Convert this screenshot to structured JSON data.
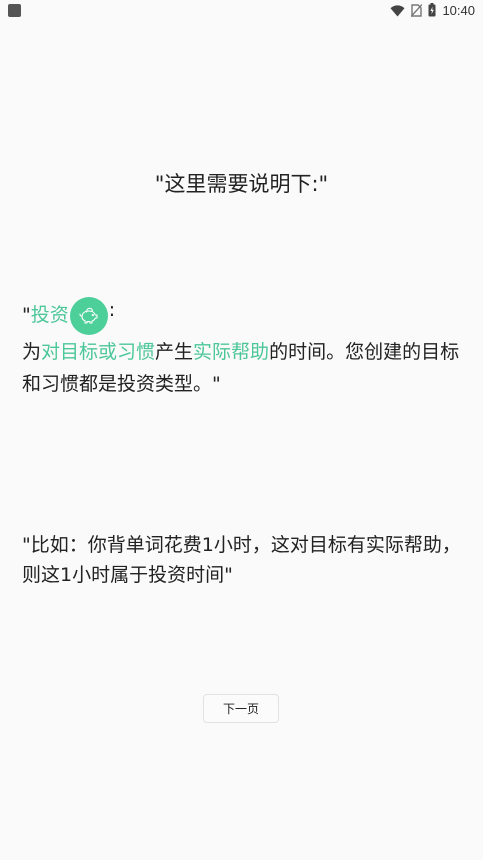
{
  "status_bar": {
    "time": "10:40",
    "icons": [
      "app-notification-icon",
      "wifi-icon",
      "no-sim-icon",
      "battery-icon"
    ]
  },
  "headline": "\"这里需要说明下:\"",
  "invest": {
    "quote_open": "\"",
    "title": "投资",
    "badge_icon": "piggy-bank-icon",
    "colon": ":",
    "desc_prefix": "为",
    "highlight_1": "对目标或习惯",
    "desc_middle": "产生",
    "highlight_2": "实际帮助",
    "desc_suffix": "的时间。您创建的目标和习惯都是投资类型。\""
  },
  "example": "\"比如：你背单词花费1小时，这对目标有实际帮助，则这1小时属于投资时间\"",
  "next_button": {
    "label": "下一页"
  },
  "colors": {
    "accent": "#4cc79a",
    "badge": "#4dcf9a",
    "background": "#fafafa",
    "text": "#222222"
  }
}
